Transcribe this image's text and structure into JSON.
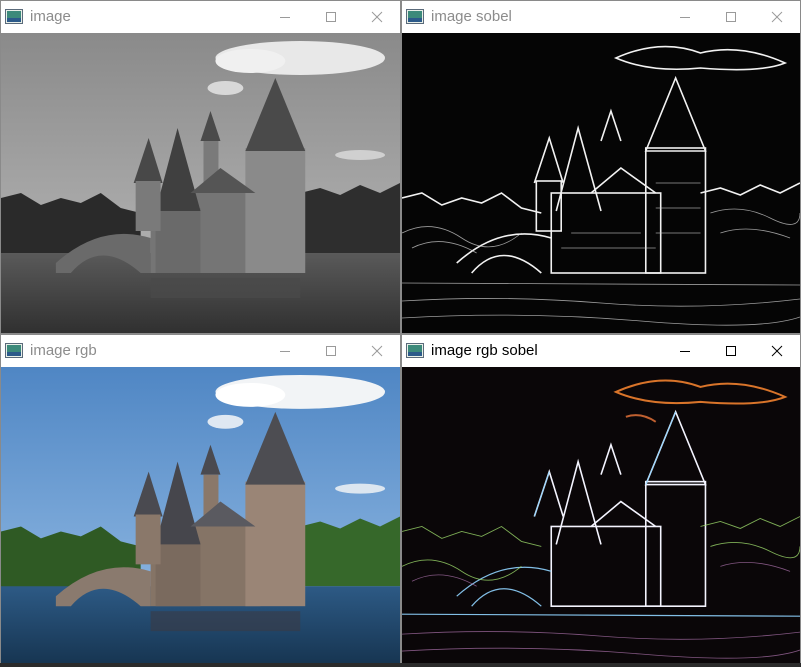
{
  "windows": [
    {
      "title": "image",
      "state": "inactive",
      "image_kind": "grayscale photo of a stone castle on water"
    },
    {
      "title": "image sobel",
      "state": "inactive",
      "image_kind": "sobel edge map (white edges on black)"
    },
    {
      "title": "image rgb",
      "state": "inactive",
      "image_kind": "color photo of a stone castle on water"
    },
    {
      "title": "image rgb sobel",
      "state": "active",
      "image_kind": "color sobel edge map"
    }
  ],
  "icons": {
    "app": "opencv-window-icon",
    "minimize": "minimize-icon",
    "maximize": "maximize-icon",
    "close": "close-icon"
  },
  "colors": {
    "titlebar_bg": "#ffffff",
    "inactive_title": "#8c8c8c",
    "active_title": "#000000",
    "sky_blue": "#6fa3d8",
    "water_blue": "#21476b"
  }
}
